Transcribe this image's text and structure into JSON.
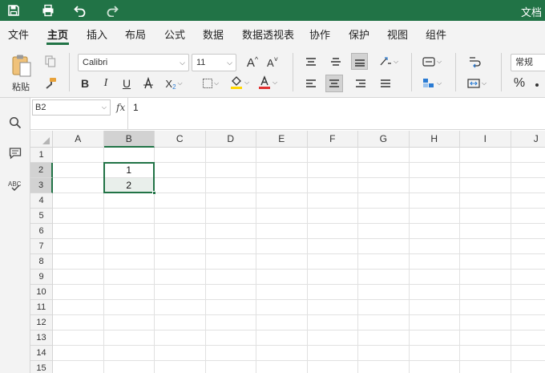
{
  "titlebar": {
    "doc_title": "文档",
    "icons": [
      "save-icon",
      "print-icon",
      "undo-icon",
      "redo-icon"
    ]
  },
  "menu": {
    "items": [
      "文件",
      "主页",
      "插入",
      "布局",
      "公式",
      "数据",
      "数据透视表",
      "协作",
      "保护",
      "视图",
      "组件"
    ],
    "active": "主页"
  },
  "ribbon": {
    "paste_label": "粘贴",
    "font_name": "Calibri",
    "font_size": "11",
    "number_format": "常规",
    "bold": "B",
    "italic": "I",
    "underline": "U",
    "font_color_letter": "A",
    "percent": "%",
    "accent_color": "#217346",
    "fill_color": "#ffd700",
    "font_color": "#e03030"
  },
  "formula_bar": {
    "cell_ref": "B2",
    "fx_label": "fx",
    "value": "1"
  },
  "sheet": {
    "columns": [
      "A",
      "B",
      "C",
      "D",
      "E",
      "F",
      "G",
      "H",
      "I",
      "J"
    ],
    "rows": [
      "1",
      "2",
      "3",
      "4",
      "5",
      "6",
      "7",
      "8",
      "9",
      "10",
      "11",
      "12",
      "13",
      "14",
      "15"
    ],
    "selected_column": "B",
    "selected_rows": [
      "2",
      "3"
    ],
    "cells": [
      {
        "ref": "B2",
        "value": "1"
      },
      {
        "ref": "B3",
        "value": "2"
      }
    ]
  },
  "side_panel": {
    "icons": [
      "search-icon",
      "comment-icon",
      "spellcheck-icon"
    ]
  }
}
